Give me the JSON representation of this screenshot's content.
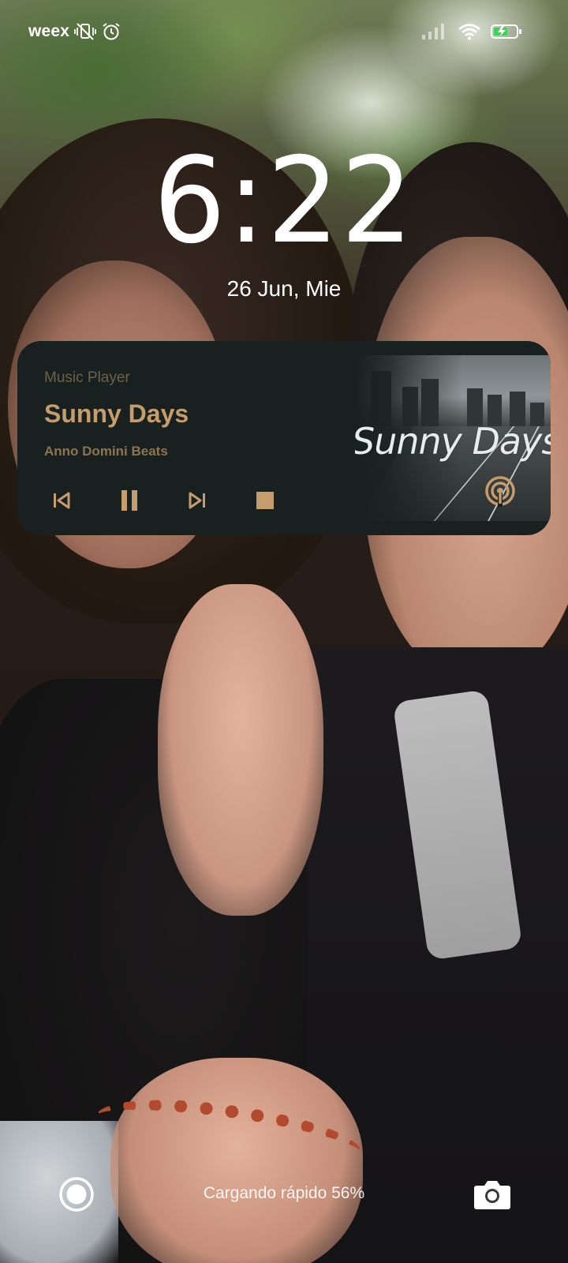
{
  "status_bar": {
    "carrier": "weex",
    "icons": [
      "vibrate-off-icon",
      "alarm-icon",
      "signal-icon",
      "wifi-icon",
      "battery-charging-icon"
    ]
  },
  "lockscreen": {
    "time": "6:22",
    "date": "26 Jun, Mie"
  },
  "media": {
    "app_name": "Music Player",
    "title": "Sunny Days",
    "artist": "Anno Domini Beats",
    "album_art_text": "Sunny Days",
    "controls": [
      "previous-icon",
      "pause-icon",
      "next-icon",
      "stop-icon",
      "cast-icon"
    ],
    "accent_color": "#c59d6c",
    "card_color": "#182020"
  },
  "bottom": {
    "charging_text": "Cargando rápido 56%",
    "left_shortcut": "assistant-icon",
    "right_shortcut": "camera-icon"
  }
}
